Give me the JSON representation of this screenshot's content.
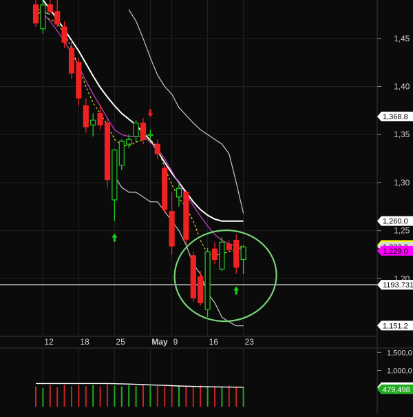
{
  "chart_data": {
    "type": "candlestick",
    "title": "",
    "price_axis": {
      "ylim": [
        1140,
        1490
      ],
      "ticks": [
        {
          "value": 1450,
          "label": "1,45"
        },
        {
          "value": 1400,
          "label": "1,40"
        },
        {
          "value": 1350,
          "label": "1,35"
        },
        {
          "value": 1300,
          "label": "1,30"
        },
        {
          "value": 1250,
          "label": "1,25"
        },
        {
          "value": 1200,
          "label": "1,20"
        }
      ]
    },
    "x_ticks": [
      {
        "index": 1,
        "label": "12"
      },
      {
        "index": 6,
        "label": "18"
      },
      {
        "index": 11,
        "label": "25"
      },
      {
        "index": 16,
        "label": "May"
      },
      {
        "index": 19,
        "label": "9"
      },
      {
        "index": 24,
        "label": "16"
      },
      {
        "index": 29,
        "label": "23"
      }
    ],
    "price_tags": [
      {
        "value": 1368.8,
        "label": "1,368.8",
        "bg": "#ffffff",
        "fg": "#000000"
      },
      {
        "value": 1260.0,
        "label": "1,260.0",
        "bg": "#ffffff",
        "fg": "#000000"
      },
      {
        "value": 1235.0,
        "label": "1,235.0",
        "bg": "#ffff00",
        "fg": "#000000"
      },
      {
        "value": 1233.3,
        "label": "1,233.3",
        "bg": "#d8d8d8",
        "fg": "#000000"
      },
      {
        "value": 1229.0,
        "label": "1,229.0",
        "bg": "#ff00ff",
        "fg": "#000000"
      },
      {
        "value": 1193.731,
        "label": "1193.731",
        "bg": "#ffffff",
        "fg": "#000000"
      },
      {
        "value": 1151.2,
        "label": "1,151.2",
        "bg": "#ffffff",
        "fg": "#000000"
      }
    ],
    "horizontal_line": 1193.731,
    "candles": [
      {
        "o": 1485,
        "h": 1500,
        "l": 1462,
        "c": 1466
      },
      {
        "o": 1460,
        "h": 1490,
        "l": 1455,
        "c": 1485
      },
      {
        "o": 1485,
        "h": 1495,
        "l": 1476,
        "c": 1478
      },
      {
        "o": 1478,
        "h": 1490,
        "l": 1462,
        "c": 1465
      },
      {
        "o": 1462,
        "h": 1468,
        "l": 1440,
        "c": 1446
      },
      {
        "o": 1440,
        "h": 1448,
        "l": 1408,
        "c": 1414
      },
      {
        "o": 1425,
        "h": 1430,
        "l": 1380,
        "c": 1388
      },
      {
        "o": 1380,
        "h": 1388,
        "l": 1352,
        "c": 1358
      },
      {
        "o": 1360,
        "h": 1372,
        "l": 1348,
        "c": 1365
      },
      {
        "o": 1372,
        "h": 1380,
        "l": 1355,
        "c": 1360
      },
      {
        "o": 1362,
        "h": 1368,
        "l": 1295,
        "c": 1303
      },
      {
        "o": 1282,
        "h": 1335,
        "l": 1260,
        "c": 1334
      },
      {
        "o": 1318,
        "h": 1345,
        "l": 1313,
        "c": 1343
      },
      {
        "o": 1340,
        "h": 1350,
        "l": 1336,
        "c": 1345
      },
      {
        "o": 1348,
        "h": 1365,
        "l": 1342,
        "c": 1362
      },
      {
        "o": 1362,
        "h": 1367,
        "l": 1340,
        "c": 1345
      },
      {
        "o": 1350,
        "h": 1355,
        "l": 1345,
        "c": 1350
      },
      {
        "o": 1340,
        "h": 1345,
        "l": 1325,
        "c": 1330
      },
      {
        "o": 1315,
        "h": 1318,
        "l": 1268,
        "c": 1272
      },
      {
        "o": 1270,
        "h": 1290,
        "l": 1225,
        "c": 1234
      },
      {
        "o": 1285,
        "h": 1300,
        "l": 1275,
        "c": 1294
      },
      {
        "o": 1290,
        "h": 1292,
        "l": 1236,
        "c": 1241
      },
      {
        "o": 1224,
        "h": 1228,
        "l": 1176,
        "c": 1180
      },
      {
        "o": 1202,
        "h": 1208,
        "l": 1172,
        "c": 1175
      },
      {
        "o": 1168,
        "h": 1232,
        "l": 1160,
        "c": 1228
      },
      {
        "o": 1231,
        "h": 1238,
        "l": 1215,
        "c": 1220
      },
      {
        "o": 1210,
        "h": 1243,
        "l": 1208,
        "c": 1238
      },
      {
        "o": 1236,
        "h": 1240,
        "l": 1228,
        "c": 1230
      },
      {
        "o": 1240,
        "h": 1246,
        "l": 1205,
        "c": 1212
      },
      {
        "o": 1220,
        "h": 1235,
        "l": 1205,
        "c": 1233
      }
    ],
    "series": [
      {
        "name": "",
        "color": "#ffffff",
        "values": [
          1495,
          1490,
          1480,
          1470,
          1459,
          1448,
          1437,
          1424,
          1411,
          1399,
          1389,
          1380,
          1372,
          1366,
          1360,
          1352,
          1344,
          1333,
          1321,
          1310,
          1300,
          1290,
          1280,
          1272,
          1266,
          1262,
          1260,
          1260,
          1260,
          1260
        ]
      },
      {
        "name": "",
        "color": "#cc44cc",
        "values": [
          1484,
          1476,
          1468,
          1458,
          1447,
          1435,
          1421,
          1406,
          1392,
          1380,
          1367,
          1355,
          1350,
          1348,
          1348,
          1348,
          1342,
          1335,
          1325,
          1312,
          1299,
          1288,
          1276,
          1265,
          1255,
          1246,
          1240,
          1236,
          1234,
          1229
        ]
      },
      {
        "name": "",
        "color": "#dddd22",
        "values": [
          1470,
          1472,
          1470,
          1466,
          1455,
          1440,
          1420,
          1400,
          1383,
          1372,
          1360,
          1345,
          1339,
          1338,
          1342,
          1345,
          1345,
          1336,
          1316,
          1298,
          1284,
          1274,
          1260,
          1240,
          1226,
          1224,
          1226,
          1228,
          1230,
          1235
        ]
      },
      {
        "name": "",
        "color": "#c8c8c8",
        "values": [
          null,
          null,
          null,
          null,
          null,
          null,
          null,
          null,
          null,
          null,
          null,
          1307,
          1295,
          1290,
          1290,
          1285,
          1280,
          1280,
          1270,
          1260,
          1250,
          1235,
          1215,
          1205,
          1185,
          1175,
          1160,
          1155,
          1151,
          1151
        ]
      },
      {
        "name": "",
        "color": "#c8c8c8",
        "values": [
          1475,
          1478,
          1475,
          null,
          null,
          null,
          null,
          null,
          null,
          null,
          null,
          null,
          null,
          1480,
          1468,
          1450,
          1430,
          1412,
          1400,
          1392,
          1378,
          1370,
          1362,
          1355,
          1350,
          1345,
          1340,
          1330,
          1300,
          1268
        ]
      }
    ],
    "arrows": [
      {
        "index": 11,
        "dir": "up",
        "color": "#22cc22"
      },
      {
        "index": 16,
        "dir": "down",
        "color": "#dd2222"
      },
      {
        "index": 28,
        "dir": "up",
        "color": "#22cc22"
      }
    ],
    "volume_axis": {
      "ticks": [
        {
          "value": 1500000,
          "label": "1,500,0"
        },
        {
          "value": 1000000,
          "label": "1,000,0"
        }
      ],
      "tags": [
        {
          "value": 537980,
          "label": "537,980",
          "bg": "#ffffff",
          "fg": "#000000"
        },
        {
          "value": 479498,
          "label": "479,498",
          "bg": "#22aa22",
          "fg": "#ffffff"
        }
      ]
    },
    "volume": [
      560000,
      520000,
      600000,
      540000,
      610000,
      560000,
      590000,
      570000,
      600000,
      560000,
      620000,
      580000,
      560000,
      600000,
      570000,
      610000,
      580000,
      570000,
      560000,
      600000,
      570000,
      580000,
      560000,
      590000,
      570000,
      560000,
      560000,
      580000,
      560000,
      540000
    ],
    "volume_avg": [
      640000,
      640000,
      640000,
      640000,
      640000,
      640000,
      640000,
      640000,
      640000,
      640000,
      640000,
      635000,
      630000,
      625000,
      618000,
      610000,
      602000,
      595000,
      588000,
      580000,
      572000,
      566000,
      560000,
      555000,
      550000,
      547000,
      545000,
      542000,
      540000,
      538000
    ],
    "annotation": {
      "type": "circle",
      "around_indices": [
        24,
        29
      ],
      "color": "#78d278"
    }
  }
}
